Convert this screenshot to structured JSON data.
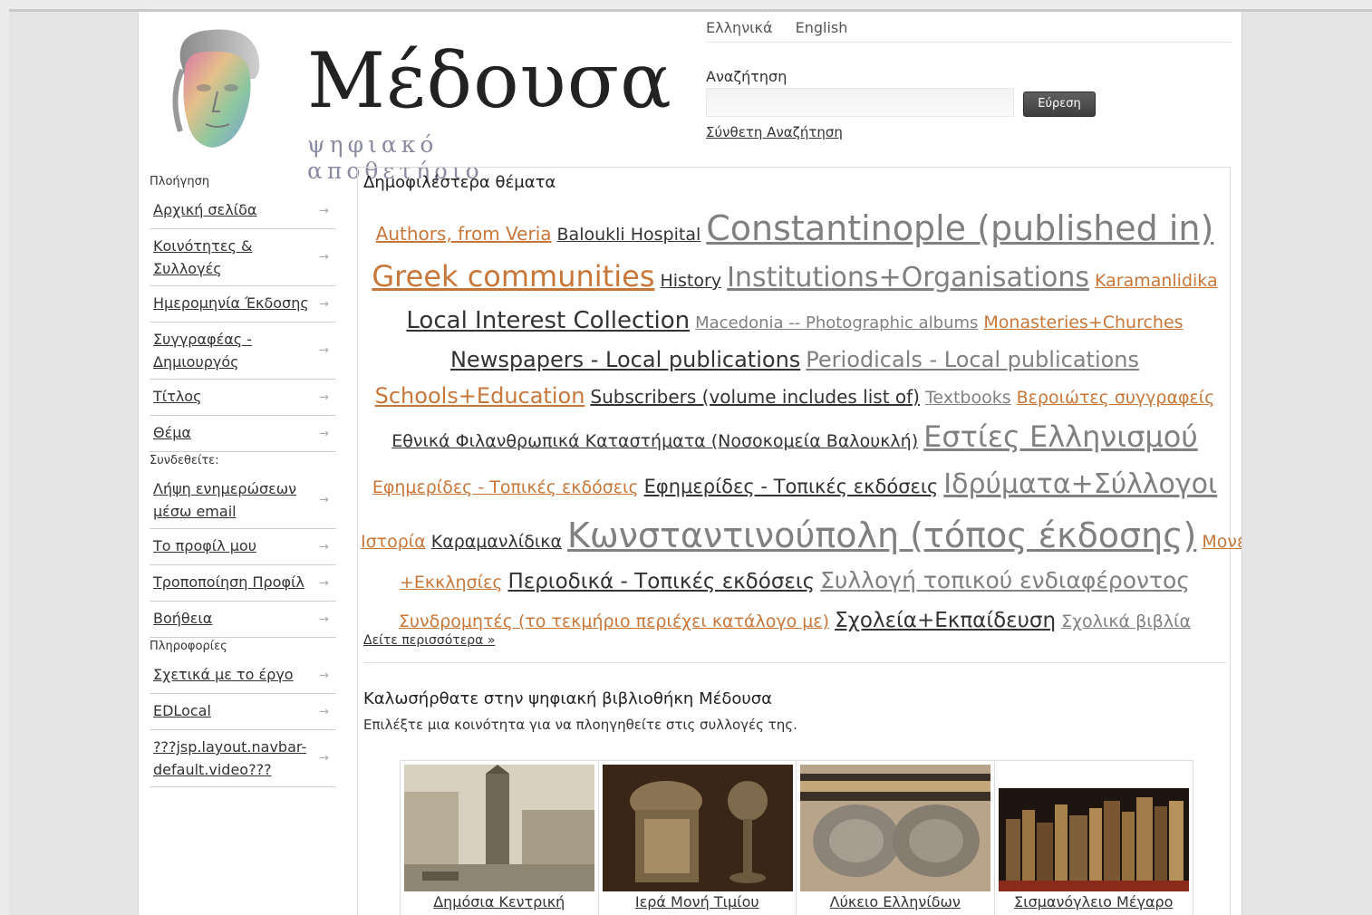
{
  "header": {
    "logo_title": "Μέδουσα",
    "logo_subtitle": "ψηφιακό αποθετήριο",
    "languages": [
      "Ελληνικά",
      "English"
    ],
    "search_label": "Αναζήτηση",
    "search_value": "",
    "search_button": "Εύρεση",
    "advanced_search": "Σύνθετη Αναζήτηση"
  },
  "sidebar": {
    "nav_heading": "Πλοήγηση",
    "nav_items": [
      {
        "label": "Αρχική σελίδα"
      },
      {
        "label": "Κοινότητες & Συλλογές"
      },
      {
        "label": "Ημερομηνία Έκδοσης"
      },
      {
        "label": "Συγγραφέας - Δημιουργός"
      },
      {
        "label": "Τίτλος"
      },
      {
        "label": "Θέμα"
      }
    ],
    "login_heading": "Συνδεθείτε:",
    "login_items": [
      {
        "label": "Λήψη ενημερώσεων μέσω email"
      },
      {
        "label": "Το προφίλ μου"
      },
      {
        "label": "Τροποποίηση Προφίλ"
      },
      {
        "label": "Βοήθεια"
      }
    ],
    "info_heading": "Πληροφορίες",
    "info_items": [
      {
        "label": "Σχετικά με το έργο"
      },
      {
        "label": "EDLocal"
      },
      {
        "label": "???jsp.layout.navbar-default.video???"
      }
    ],
    "arrow_glyph": "→"
  },
  "main": {
    "section_title": "Δημοφιλέστερα θέματα",
    "see_more": "Δείτε περισσότερα »",
    "welcome_title": "Καλωσήρθατε στην ψηφιακή βιβλιοθήκη Μέδουσα",
    "welcome_text": "Επιλέξτε μια κοινότητα για να πλοηγηθείτε στις συλλογές της.",
    "colors": {
      "orange": "#c8773a",
      "dark": "#333333",
      "gray": "#808080"
    },
    "tag_lines": [
      [
        {
          "text": "Authors, from Veria",
          "size": 20,
          "color": "#c8773a"
        },
        {
          "text": "Baloukli Hospital",
          "size": 19,
          "color": "#333333"
        },
        {
          "text": "Constantinople (published in)",
          "size": 38,
          "color": "#808080"
        }
      ],
      [
        {
          "text": "Greek communities",
          "size": 32,
          "color": "#c8773a"
        },
        {
          "text": "History",
          "size": 19,
          "color": "#333333"
        },
        {
          "text": "Institutions+Organisations",
          "size": 30,
          "color": "#808080"
        },
        {
          "text": "Karamanlidika",
          "size": 19,
          "color": "#c8773a"
        }
      ],
      [
        {
          "text": "Local Interest Collection",
          "size": 26,
          "color": "#333333"
        },
        {
          "text": "Macedonia -- Photographic albums",
          "size": 18,
          "color": "#808080"
        },
        {
          "text": "Monasteries+Churches",
          "size": 19,
          "color": "#c8773a"
        }
      ],
      [
        {
          "text": "Newspapers - Local publications",
          "size": 24,
          "color": "#333333"
        },
        {
          "text": "Periodicals - Local publications",
          "size": 24,
          "color": "#808080"
        }
      ],
      [
        {
          "text": "Schools+Education",
          "size": 24,
          "color": "#c8773a"
        },
        {
          "text": "Subscribers (volume includes list of)",
          "size": 20,
          "color": "#333333"
        },
        {
          "text": "Textbooks",
          "size": 19,
          "color": "#808080"
        },
        {
          "text": "Βεροιώτες συγγραφείς",
          "size": 19,
          "color": "#c8773a"
        }
      ],
      [
        {
          "text": "Εθνικά Φιλανθρωπικά Καταστήματα (Νοσοκομεία Βαλουκλή)",
          "size": 19,
          "color": "#333333"
        },
        {
          "text": "Εστίες Ελληνισμού",
          "size": 32,
          "color": "#808080"
        }
      ],
      [
        {
          "text": "Εφημερίδες - Τοπικές εκδόσεις",
          "size": 19,
          "color": "#c8773a"
        },
        {
          "text": "Εφημερίδες - Τοπικές εκδόσεις",
          "size": 21,
          "color": "#333333"
        },
        {
          "text": "Ιδρύματα+Σύλλογοι",
          "size": 30,
          "color": "#808080"
        }
      ],
      [
        {
          "text": "Ιστορία",
          "size": 19,
          "color": "#c8773a"
        },
        {
          "text": "Καραμανλίδικα",
          "size": 19,
          "color": "#333333"
        },
        {
          "text": "Κωνσταντινούπολη (τόπος έκδοσης)",
          "size": 38,
          "color": "#808080"
        },
        {
          "text": "Μονές",
          "size": 19,
          "color": "#c8773a"
        }
      ],
      [
        {
          "text": "+Εκκλησίες",
          "size": 19,
          "color": "#c8773a"
        },
        {
          "text": "Περιοδικά - Τοπικές εκδόσεις",
          "size": 23,
          "color": "#333333"
        },
        {
          "text": "Συλλογή τοπικού ενδιαφέροντος",
          "size": 25,
          "color": "#808080"
        }
      ],
      [
        {
          "text": "Συνδρομητές (το τεκμήριο περιέχει κατάλογο με)",
          "size": 19,
          "color": "#c8773a"
        },
        {
          "text": "Σχολεία+Εκπαίδευση",
          "size": 23,
          "color": "#333333"
        },
        {
          "text": "Σχολικά βιβλία",
          "size": 19,
          "color": "#808080"
        }
      ]
    ],
    "communities": [
      {
        "caption": "Δημόσια Κεντρική"
      },
      {
        "caption": "Ιερά Μονή Τιμίου"
      },
      {
        "caption": "Λύκειο Ελληνίδων"
      },
      {
        "caption": "Σισμανόγλειο Μέγαρο"
      }
    ]
  }
}
